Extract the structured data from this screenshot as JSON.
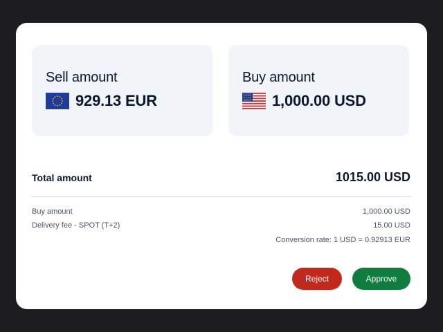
{
  "sell": {
    "title": "Sell amount",
    "value": "929.13 EUR",
    "flag_icon": "eu-flag-icon"
  },
  "buy": {
    "title": "Buy amount",
    "value": "1,000.00 USD",
    "flag_icon": "us-flag-icon"
  },
  "total": {
    "label": "Total amount",
    "value": "1015.00 USD"
  },
  "details": [
    {
      "label": "Buy amount",
      "value": "1,000.00 USD"
    },
    {
      "label": "Delivery fee - SPOT (T+2)",
      "value": "15.00 USD"
    }
  ],
  "conversion_rate": "Conversion rate: 1 USD = 0.92913 EUR",
  "buttons": {
    "reject_label": "Reject",
    "approve_label": "Approve"
  },
  "colors": {
    "reject": "#c1291c",
    "approve": "#107c3d",
    "panel": "#f1f5f9",
    "text": "#0c1730"
  }
}
